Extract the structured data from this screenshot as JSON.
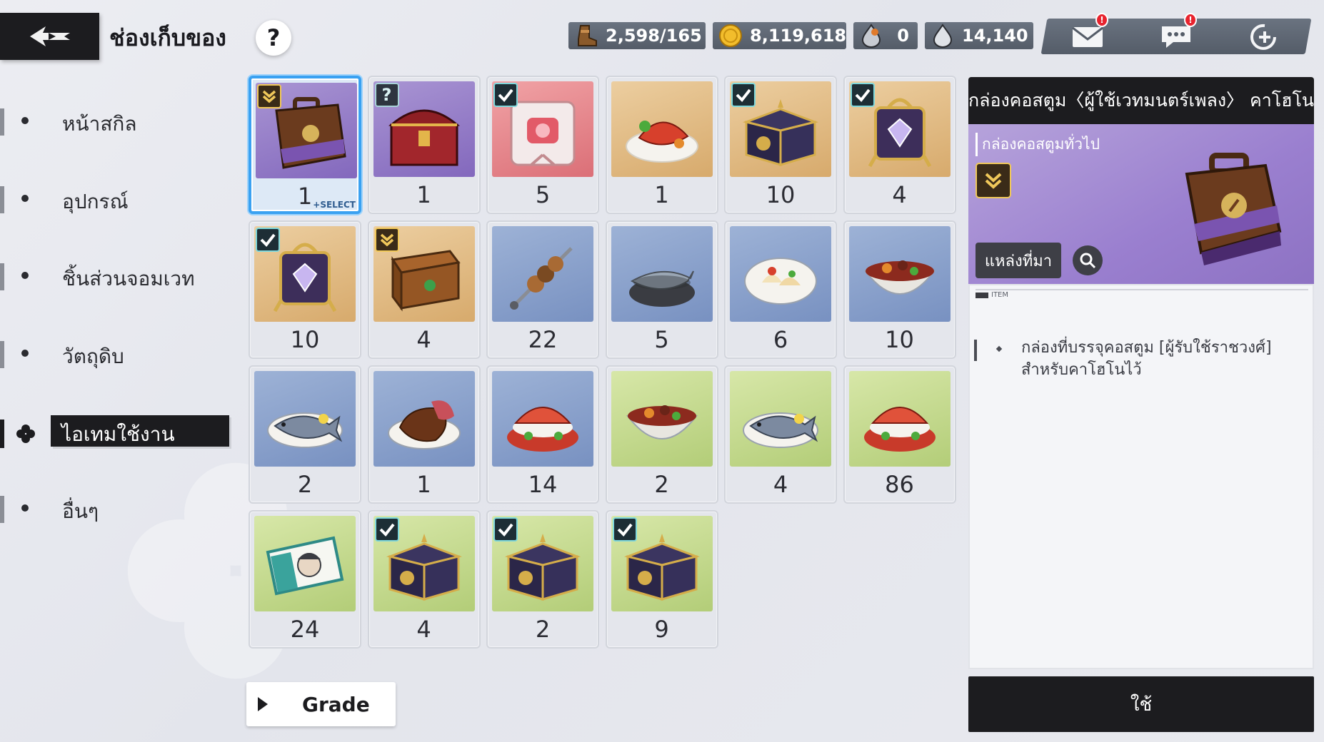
{
  "header": {
    "title": "ช่องเก็บของ",
    "help_label": "?"
  },
  "currencies": [
    {
      "icon": "boot-icon",
      "value": "2,598/165"
    },
    {
      "icon": "gold-coin-icon",
      "value": "8,119,618"
    },
    {
      "icon": "crystal-drop-icon",
      "value": "0"
    },
    {
      "icon": "mana-drop-icon",
      "value": "14,140"
    }
  ],
  "top_actions": [
    {
      "icon": "mail-icon",
      "has_notification": true,
      "notif_label": "!"
    },
    {
      "icon": "chat-icon",
      "has_notification": true,
      "notif_label": "!"
    },
    {
      "icon": "add-friend-icon",
      "has_notification": false
    }
  ],
  "sidebar": {
    "items": [
      {
        "label": "หน้าสกิล",
        "active": false
      },
      {
        "label": "อุปกรณ์",
        "active": false
      },
      {
        "label": "ชิ้นส่วนจอมเวท",
        "active": false
      },
      {
        "label": "วัตถุดิบ",
        "active": false
      },
      {
        "label": "ไอเทมใช้งาน",
        "active": true
      },
      {
        "label": "อื่นๆ",
        "active": false
      }
    ]
  },
  "grid": {
    "select_tag": "+SELECT",
    "items": [
      {
        "name": "costume-box-suitcase",
        "bg": "purple",
        "badge": "grade",
        "qty": "1",
        "selected": true,
        "art": "suitcase-icon"
      },
      {
        "name": "mystery-chest",
        "bg": "purple",
        "badge": "unknown",
        "qty": "1",
        "art": "red-chest-icon"
      },
      {
        "name": "gift-box",
        "bg": "pink",
        "badge": "check",
        "qty": "5",
        "art": "gift-box-icon"
      },
      {
        "name": "lobster-plate",
        "bg": "orange",
        "badge": "",
        "qty": "1",
        "art": "lobster-dish-icon"
      },
      {
        "name": "dark-chest",
        "bg": "orange",
        "badge": "check",
        "qty": "10",
        "art": "dark-chest-icon"
      },
      {
        "name": "crystal-lantern",
        "bg": "orange",
        "badge": "check",
        "qty": "4",
        "art": "crystal-lantern-icon"
      },
      {
        "name": "crystal-lantern",
        "bg": "orange",
        "badge": "check",
        "qty": "10",
        "art": "crystal-lantern-icon"
      },
      {
        "name": "leather-chest",
        "bg": "orange",
        "badge": "grade",
        "qty": "4",
        "art": "leather-chest-icon"
      },
      {
        "name": "meat-skewer",
        "bg": "blue",
        "badge": "",
        "qty": "22",
        "art": "skewer-icon"
      },
      {
        "name": "fish-pot",
        "bg": "blue",
        "badge": "",
        "qty": "5",
        "art": "fish-pot-icon"
      },
      {
        "name": "dumpling-plate",
        "bg": "blue",
        "badge": "",
        "qty": "6",
        "art": "dumpling-icon"
      },
      {
        "name": "stew-bowl",
        "bg": "blue",
        "badge": "",
        "qty": "10",
        "art": "stew-bowl-icon"
      },
      {
        "name": "fish-plate",
        "bg": "blue",
        "badge": "",
        "qty": "2",
        "art": "fish-plate-icon"
      },
      {
        "name": "steak-plate",
        "bg": "blue",
        "badge": "",
        "qty": "1",
        "art": "steak-icon"
      },
      {
        "name": "crab-burger",
        "bg": "blue",
        "badge": "",
        "qty": "14",
        "art": "crab-burger-icon"
      },
      {
        "name": "stew-bowl",
        "bg": "green",
        "badge": "",
        "qty": "2",
        "art": "stew-bowl-icon"
      },
      {
        "name": "fish-plate",
        "bg": "green",
        "badge": "",
        "qty": "4",
        "art": "fish-plate-icon"
      },
      {
        "name": "crab-burger",
        "bg": "green",
        "badge": "",
        "qty": "86",
        "art": "crab-burger-icon"
      },
      {
        "name": "portrait-ticket",
        "bg": "green",
        "badge": "",
        "qty": "24",
        "art": "ticket-icon"
      },
      {
        "name": "dark-chest",
        "bg": "green",
        "badge": "check",
        "qty": "4",
        "art": "dark-chest-icon"
      },
      {
        "name": "dark-chest",
        "bg": "green",
        "badge": "check",
        "qty": "2",
        "art": "dark-chest-icon"
      },
      {
        "name": "dark-chest",
        "bg": "green",
        "badge": "check",
        "qty": "9",
        "art": "dark-chest-icon"
      }
    ]
  },
  "filter": {
    "label": "Grade"
  },
  "detail": {
    "title": "กล่องคอสตูม〈ผู้ใช้เวทมนตร์เพลง〉 คาโฮโน",
    "category": "กล่องคอสตูมทั่วไป",
    "source_label": "แหล่งที่มา",
    "item_tag": "ITEM",
    "description": "กล่องที่บรรจุคอสตูม [ผู้รับใช้ราชวงศ์] สำหรับคาโฮโนไว้",
    "use_label": "ใช้"
  },
  "colors": {
    "dark": "#1c1c1f",
    "selected_border": "#3aa1f1",
    "notification": "#e8232e",
    "check_badge": "#7fd8dc",
    "grade_badge": "#f0c85a"
  }
}
